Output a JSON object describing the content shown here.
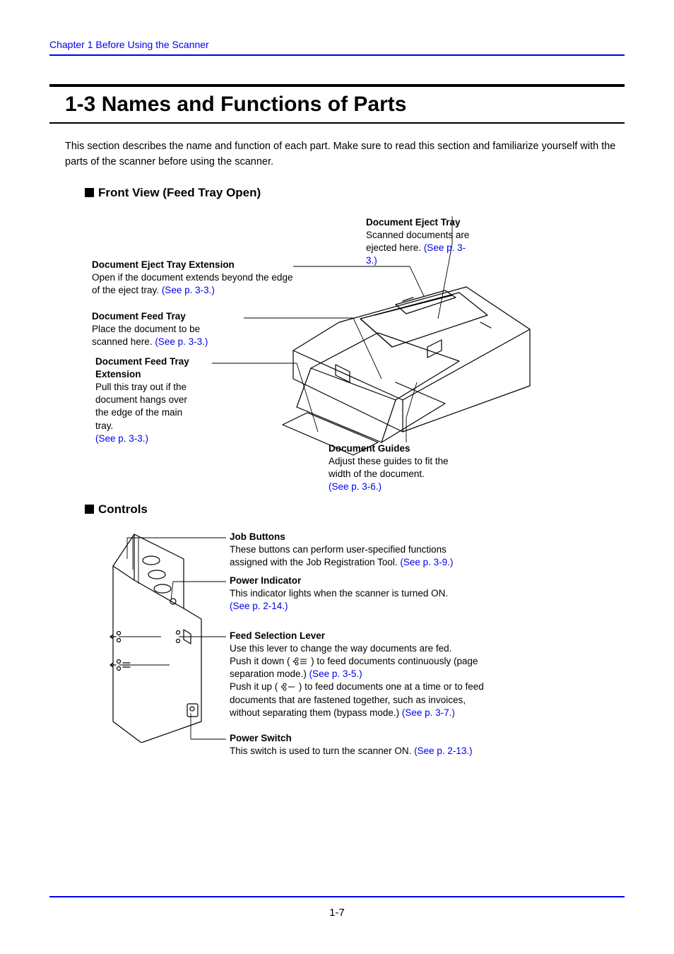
{
  "header": "Chapter 1   Before Using the Scanner",
  "title": "1-3  Names and Functions of Parts",
  "intro": "This section describes the name and function of each part. Make sure to read this section and familiarize yourself with the parts of the scanner before using the scanner.",
  "h_front": "Front View (Feed Tray Open)",
  "h_ctrl": "Controls",
  "page_num": "1-7",
  "fv": {
    "eject_ext": {
      "t": "Document Eject Tray Extension",
      "d": "Open if the document extends beyond the edge of the eject tray. ",
      "l": "(See p. 3-3.)"
    },
    "feed_tray": {
      "t": "Document Feed Tray",
      "d": "Place the document to be scanned here. ",
      "l": "(See p. 3-3.)"
    },
    "feed_ext": {
      "t": "Document Feed Tray Extension",
      "d": "Pull this tray out if the document hangs over the edge of the main tray.",
      "l": "(See p. 3-3.)"
    },
    "eject_tray": {
      "t": "Document Eject Tray",
      "d": "Scanned documents are ejected here. ",
      "l": "(See p. 3-3.)"
    },
    "guides": {
      "t": "Document Guides",
      "d": "Adjust these guides to fit the width of the document.",
      "l": "(See p. 3-6.)"
    }
  },
  "ctrl": {
    "job": {
      "t": "Job Buttons",
      "d": "These buttons can perform user-specified functions assigned with the Job Registration Tool. ",
      "l": "(See p. 3-9.)"
    },
    "power_ind": {
      "t": "Power Indicator",
      "d": "This indicator lights when the scanner is turned ON.",
      "l": "(See p. 2-14.)"
    },
    "feed_lever": {
      "t": "Feed Selection Lever",
      "d1": "Use this lever to change the way documents are fed.",
      "d2a": "Push it down (",
      "d2b": ") to feed documents continuously (page separation mode.) ",
      "l2": "(See p. 3-5.)",
      "d3a": "Push it up (",
      "d3b": ") to feed documents one at a time or to feed documents that are fastened together, such as invoices, without separating them (bypass mode.) ",
      "l3": "(See p. 3-7.)"
    },
    "power_sw": {
      "t": "Power Switch",
      "d": "This switch is used to turn the scanner ON. ",
      "l": "(See p. 2-13.)"
    }
  }
}
